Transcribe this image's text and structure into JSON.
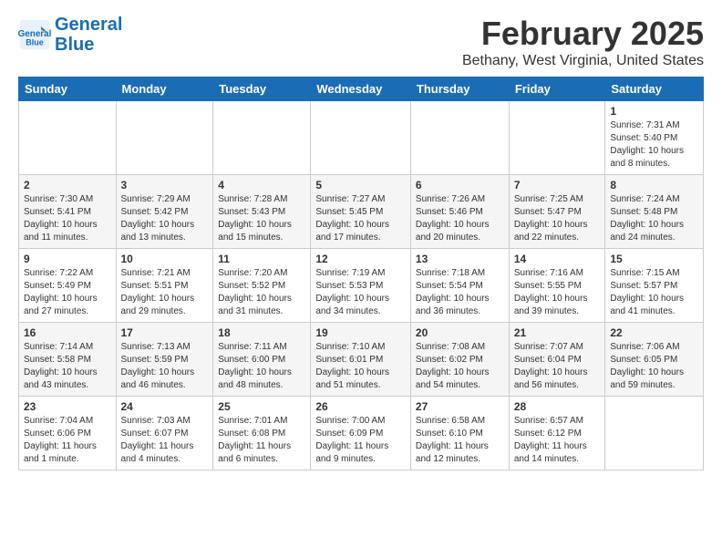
{
  "header": {
    "logo_line1": "General",
    "logo_line2": "Blue",
    "month": "February 2025",
    "location": "Bethany, West Virginia, United States"
  },
  "days_of_week": [
    "Sunday",
    "Monday",
    "Tuesday",
    "Wednesday",
    "Thursday",
    "Friday",
    "Saturday"
  ],
  "weeks": [
    [
      {
        "day": "",
        "info": ""
      },
      {
        "day": "",
        "info": ""
      },
      {
        "day": "",
        "info": ""
      },
      {
        "day": "",
        "info": ""
      },
      {
        "day": "",
        "info": ""
      },
      {
        "day": "",
        "info": ""
      },
      {
        "day": "1",
        "info": "Sunrise: 7:31 AM\nSunset: 5:40 PM\nDaylight: 10 hours and 8 minutes."
      }
    ],
    [
      {
        "day": "2",
        "info": "Sunrise: 7:30 AM\nSunset: 5:41 PM\nDaylight: 10 hours and 11 minutes."
      },
      {
        "day": "3",
        "info": "Sunrise: 7:29 AM\nSunset: 5:42 PM\nDaylight: 10 hours and 13 minutes."
      },
      {
        "day": "4",
        "info": "Sunrise: 7:28 AM\nSunset: 5:43 PM\nDaylight: 10 hours and 15 minutes."
      },
      {
        "day": "5",
        "info": "Sunrise: 7:27 AM\nSunset: 5:45 PM\nDaylight: 10 hours and 17 minutes."
      },
      {
        "day": "6",
        "info": "Sunrise: 7:26 AM\nSunset: 5:46 PM\nDaylight: 10 hours and 20 minutes."
      },
      {
        "day": "7",
        "info": "Sunrise: 7:25 AM\nSunset: 5:47 PM\nDaylight: 10 hours and 22 minutes."
      },
      {
        "day": "8",
        "info": "Sunrise: 7:24 AM\nSunset: 5:48 PM\nDaylight: 10 hours and 24 minutes."
      }
    ],
    [
      {
        "day": "9",
        "info": "Sunrise: 7:22 AM\nSunset: 5:49 PM\nDaylight: 10 hours and 27 minutes."
      },
      {
        "day": "10",
        "info": "Sunrise: 7:21 AM\nSunset: 5:51 PM\nDaylight: 10 hours and 29 minutes."
      },
      {
        "day": "11",
        "info": "Sunrise: 7:20 AM\nSunset: 5:52 PM\nDaylight: 10 hours and 31 minutes."
      },
      {
        "day": "12",
        "info": "Sunrise: 7:19 AM\nSunset: 5:53 PM\nDaylight: 10 hours and 34 minutes."
      },
      {
        "day": "13",
        "info": "Sunrise: 7:18 AM\nSunset: 5:54 PM\nDaylight: 10 hours and 36 minutes."
      },
      {
        "day": "14",
        "info": "Sunrise: 7:16 AM\nSunset: 5:55 PM\nDaylight: 10 hours and 39 minutes."
      },
      {
        "day": "15",
        "info": "Sunrise: 7:15 AM\nSunset: 5:57 PM\nDaylight: 10 hours and 41 minutes."
      }
    ],
    [
      {
        "day": "16",
        "info": "Sunrise: 7:14 AM\nSunset: 5:58 PM\nDaylight: 10 hours and 43 minutes."
      },
      {
        "day": "17",
        "info": "Sunrise: 7:13 AM\nSunset: 5:59 PM\nDaylight: 10 hours and 46 minutes."
      },
      {
        "day": "18",
        "info": "Sunrise: 7:11 AM\nSunset: 6:00 PM\nDaylight: 10 hours and 48 minutes."
      },
      {
        "day": "19",
        "info": "Sunrise: 7:10 AM\nSunset: 6:01 PM\nDaylight: 10 hours and 51 minutes."
      },
      {
        "day": "20",
        "info": "Sunrise: 7:08 AM\nSunset: 6:02 PM\nDaylight: 10 hours and 54 minutes."
      },
      {
        "day": "21",
        "info": "Sunrise: 7:07 AM\nSunset: 6:04 PM\nDaylight: 10 hours and 56 minutes."
      },
      {
        "day": "22",
        "info": "Sunrise: 7:06 AM\nSunset: 6:05 PM\nDaylight: 10 hours and 59 minutes."
      }
    ],
    [
      {
        "day": "23",
        "info": "Sunrise: 7:04 AM\nSunset: 6:06 PM\nDaylight: 11 hours and 1 minute."
      },
      {
        "day": "24",
        "info": "Sunrise: 7:03 AM\nSunset: 6:07 PM\nDaylight: 11 hours and 4 minutes."
      },
      {
        "day": "25",
        "info": "Sunrise: 7:01 AM\nSunset: 6:08 PM\nDaylight: 11 hours and 6 minutes."
      },
      {
        "day": "26",
        "info": "Sunrise: 7:00 AM\nSunset: 6:09 PM\nDaylight: 11 hours and 9 minutes."
      },
      {
        "day": "27",
        "info": "Sunrise: 6:58 AM\nSunset: 6:10 PM\nDaylight: 11 hours and 12 minutes."
      },
      {
        "day": "28",
        "info": "Sunrise: 6:57 AM\nSunset: 6:12 PM\nDaylight: 11 hours and 14 minutes."
      },
      {
        "day": "",
        "info": ""
      }
    ]
  ]
}
